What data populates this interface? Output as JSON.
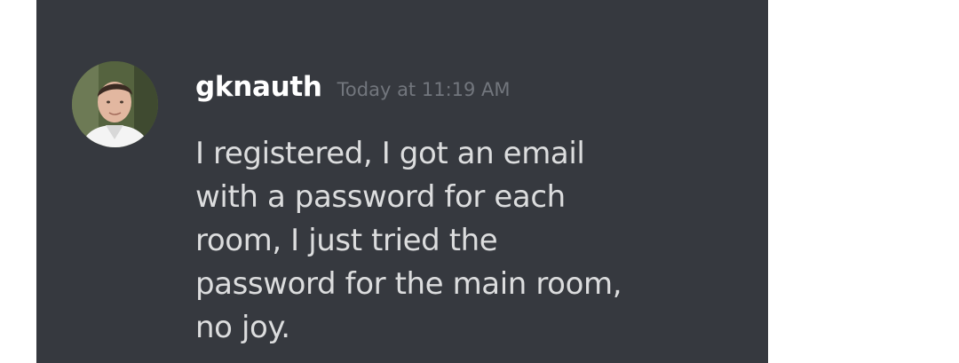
{
  "message": {
    "username": "gknauth",
    "timestamp": "Today at 11:19 AM",
    "text": "I registered, I got an email\nwith a password for each\nroom, I just tried the\npassword for the main room,\nno joy."
  },
  "colors": {
    "panel_background": "#36393f",
    "username": "#ffffff",
    "timestamp": "#72767d",
    "message_text": "#dcddde"
  },
  "icons": {
    "avatar": "user-avatar-photo"
  }
}
